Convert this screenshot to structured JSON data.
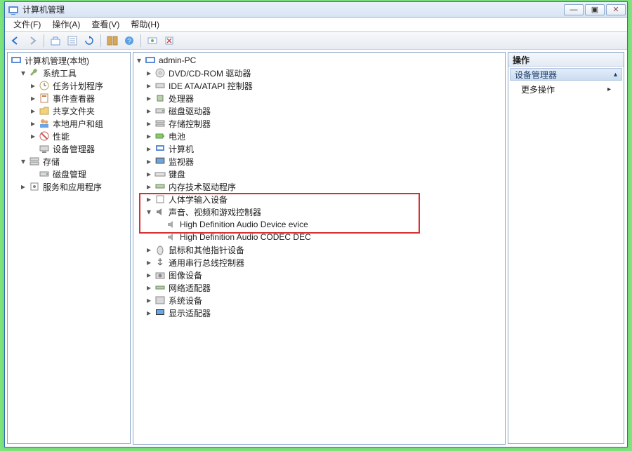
{
  "window": {
    "title": "计算机管理",
    "btn_min": "—",
    "btn_max": "▣",
    "btn_close": "✕"
  },
  "menu": {
    "file": "文件(F)",
    "action": "操作(A)",
    "view": "查看(V)",
    "help": "帮助(H)"
  },
  "left_tree": {
    "root": "计算机管理(本地)",
    "system_tools": "系统工具",
    "task_scheduler": "任务计划程序",
    "event_viewer": "事件查看器",
    "shared_folders": "共享文件夹",
    "local_users": "本地用户和组",
    "performance": "性能",
    "device_manager": "设备管理器",
    "storage": "存储",
    "disk_mgmt": "磁盘管理",
    "services_apps": "服务和应用程序"
  },
  "mid_tree": {
    "root": "admin-PC",
    "dvd": "DVD/CD-ROM 驱动器",
    "ide": "IDE ATA/ATAPI 控制器",
    "cpu": "处理器",
    "disk": "磁盘驱动器",
    "storage_ctrl": "存储控制器",
    "battery": "电池",
    "computer": "计算机",
    "monitor": "监视器",
    "keyboard": "键盘",
    "memory": "内存技术驱动程序",
    "hid": "人体学输入设备",
    "sound": "声音、视频和游戏控制器",
    "sound_dev1": "High Definition Audio Device evice",
    "sound_dev2": "High Definition Audio CODEC DEC",
    "mouse": "鼠标和其他指针设备",
    "usb": "通用串行总线控制器",
    "imaging": "图像设备",
    "network": "网络适配器",
    "system": "系统设备",
    "display": "显示适配器"
  },
  "right_pane": {
    "header": "操作",
    "section": "设备管理器",
    "more_actions": "更多操作"
  }
}
